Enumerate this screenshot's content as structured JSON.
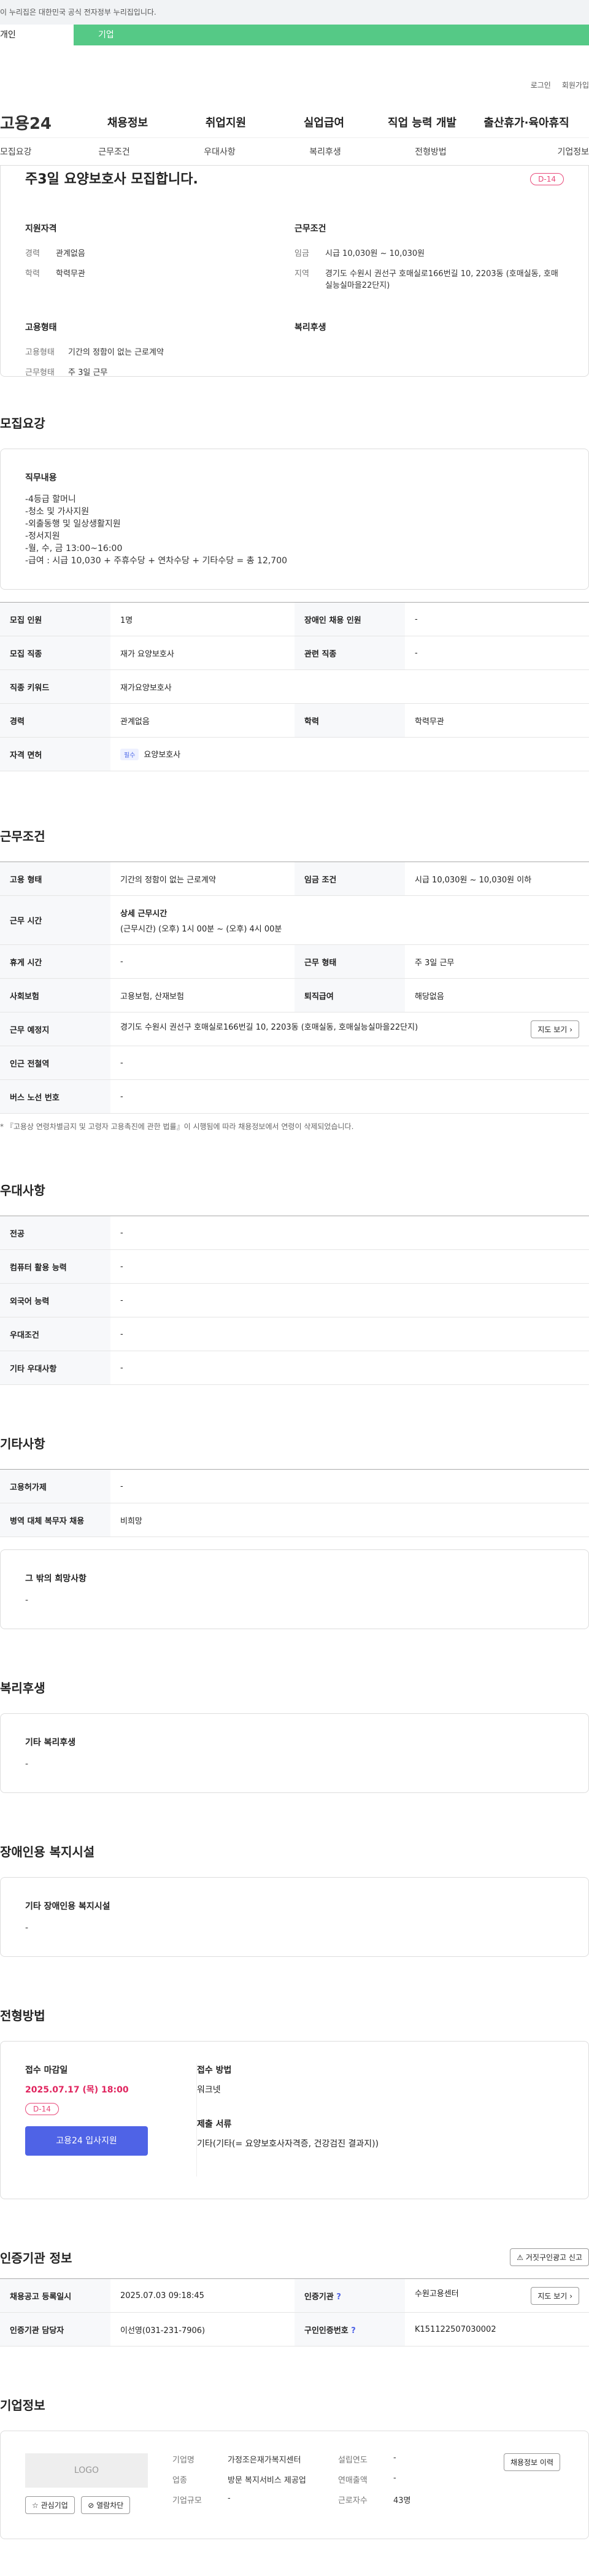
{
  "notice": "이 누리집은 대한민국 공식 전자정부 누리집입니다.",
  "group_tabs": [
    "개인",
    "기업"
  ],
  "utility": [
    "로그인",
    "회원가입"
  ],
  "gnb": {
    "logo": "고용24",
    "items": [
      "채용정보",
      "취업지원",
      "실업급여",
      "직업 능력 개발",
      "출산휴가·육아휴직"
    ]
  },
  "subnav": [
    "모집요강",
    "근무조건",
    "우대사항",
    "복리후생",
    "전형방법",
    "기업정보"
  ],
  "summary": {
    "title": "주3일 요양보호사 모집합니다.",
    "dday": "D-14",
    "qual_h": "지원자격",
    "cond_h": "근무조건",
    "type_h": "고용형태",
    "welfare_h": "복리후생",
    "career_k": "경력",
    "career_v": "관계없음",
    "edu_k": "학력",
    "edu_v": "학력무관",
    "wage_k": "임금",
    "wage_v": "시급 10,030원 ~ 10,030원",
    "region_k": "지역",
    "region_v": "경기도 수원시 권선구 호매실로166번길 10, 2203동 (호매실동, 호매실능실마을22단지)",
    "emp_k": "고용형태",
    "emp_v": "기간의 정함이 없는 근로계약",
    "work_k": "근무형태",
    "work_v": "주 3일 근무"
  },
  "recruit": {
    "heading": "모집요강",
    "duty_label": "직무내용",
    "duty": "-4등급 할머니\n-청소 및 가사지원\n-외출동행 및 일상생활지원\n-정서지원\n-월, 수, 금 13:00~16:00\n-급여 : 시급 10,030 + 주휴수당 + 연차수당 + 기타수당 = 총 12,700",
    "rows": [
      [
        "모집 인원",
        "1명",
        "장애인 채용 인원",
        "-"
      ],
      [
        "모집 직종",
        "재가 요양보호사",
        "관련 직종",
        "-"
      ],
      [
        "직종 키워드",
        "재가요양보호사",
        "",
        ""
      ],
      [
        "경력",
        "관계없음",
        "학력",
        "학력무관"
      ],
      [
        "자격 면허",
        "요양보호사",
        "",
        ""
      ]
    ],
    "chip": "필수"
  },
  "conditions": {
    "heading": "근무조건",
    "emp_type_k": "고용 형태",
    "emp_type_v": "기간의 정함이 없는 근로계약",
    "wage_k": "임금 조건",
    "wage_v": "시급 10,030원 ~ 10,030원 이하",
    "hours_k": "근무 시간",
    "hours_title": "상세 근무시간",
    "hours_v": "(근무시간) (오후) 1시 00분 ~ (오후) 4시 00분",
    "rest_k": "휴게 시간",
    "rest_v": "-",
    "form_k": "근무 형태",
    "form_v": "주 3일 근무",
    "ins_k": "사회보험",
    "ins_v": "고용보험, 산재보험",
    "sev_k": "퇴직급여",
    "sev_v": "해당없음",
    "place_k": "근무 예정지",
    "place_v": "경기도 수원시 권선구 호매실로166번길 10, 2203동 (호매실동, 호매실능실마을22단지)",
    "map_btn": "지도 보기",
    "subway_k": "인근 전철역",
    "subway_v": "-",
    "bus_k": "버스 노선 번호",
    "bus_v": "-",
    "note": "* 『고용상 연령차별금지 및 고령자 고용촉진에 관한 법률』이 시행됨에 따라 채용정보에서 연령이 삭제되었습니다."
  },
  "preference": {
    "heading": "우대사항",
    "rows": [
      [
        "전공",
        "-"
      ],
      [
        "컴퓨터 활용 능력",
        "-"
      ],
      [
        "외국어 능력",
        "-"
      ],
      [
        "우대조건",
        "-"
      ],
      [
        "기타 우대사항",
        "-"
      ]
    ]
  },
  "others": {
    "heading": "기타사항",
    "rows": [
      [
        "고용허가제",
        "-"
      ],
      [
        "병역 대체 복무자 채용",
        "비희망"
      ]
    ],
    "extra_label": "그 밖의 희망사항",
    "extra_v": "-"
  },
  "welfare": {
    "heading": "복리후생",
    "label": "기타 복리후생",
    "v": "-"
  },
  "disabled": {
    "heading": "장애인용 복지시설",
    "label": "기타 장애인용 복지시설",
    "v": "-"
  },
  "selection": {
    "heading": "전형방법",
    "deadline_label": "접수 마감일",
    "deadline": "2025.07.17 (목) 18:00",
    "dday": "D-14",
    "apply_btn": "고용24 입사지원",
    "method_label": "접수 방법",
    "method_v": "워크넷",
    "docs_label": "제출 서류",
    "docs_v": "기타(기타(= 요양보호사자격증, 건강검진 결과지))"
  },
  "agency": {
    "heading": "인증기관 정보",
    "report_btn": "거짓구인광고 신고",
    "reg_k": "채용공고 등록일시",
    "reg_v": "2025.07.03 09:18:45",
    "org_k": "인증기관",
    "org_v": "수원고용센터",
    "map_btn": "지도 보기",
    "mgr_k": "인증기관 담당자",
    "mgr_v": "이선영(031-231-7906)",
    "num_k": "구인인증번호",
    "num_v": "K151122507030002"
  },
  "company": {
    "heading": "기업정보",
    "logo": "LOGO",
    "fav_btn": "관심기업",
    "block_btn": "열람차단",
    "name_k": "기업명",
    "name_v": "가정조은재가복지센터",
    "ind_k": "업종",
    "ind_v": "방문 복지서비스 제공업",
    "size_k": "기업규모",
    "size_v": "-",
    "est_k": "설립연도",
    "est_v": "-",
    "sales_k": "연매출액",
    "sales_v": "-",
    "emp_k": "근로자수",
    "emp_v": "43명",
    "history_btn": "채용정보 이력"
  }
}
